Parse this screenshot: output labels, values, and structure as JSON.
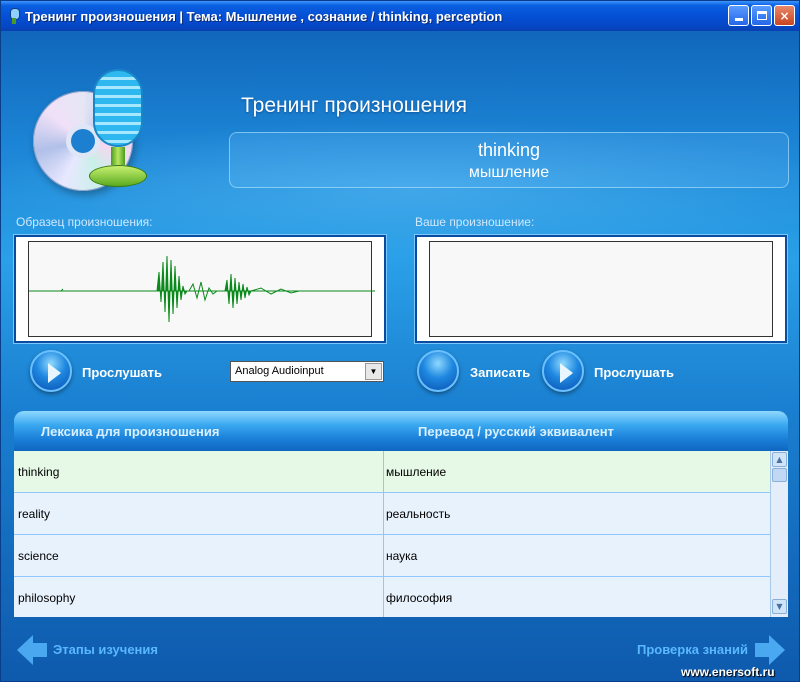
{
  "window": {
    "title": "Тренинг произношения | Тема:  Мышление , сознание / thinking, perception",
    "minimize_label": "",
    "maximize_label": "",
    "close_label": "×"
  },
  "header": {
    "app_title": "Тренинг произношения",
    "word_en": "thinking",
    "word_ru": "мышление"
  },
  "sample": {
    "label": "Образец произношения:",
    "play_label": "Прослушать"
  },
  "yours": {
    "label": "Ваше  произношение:",
    "record_label": "Записать",
    "play_label": "Прослушать"
  },
  "audio_input": {
    "selected": "Analog Audioinput",
    "arrow": "▼"
  },
  "table": {
    "col_vocab": "Лексика для произношения",
    "col_translation": "Перевод / русский эквивалент",
    "rows": [
      {
        "en": "thinking",
        "ru": "мышление"
      },
      {
        "en": "reality",
        "ru": "реальность"
      },
      {
        "en": "science",
        "ru": "наука"
      },
      {
        "en": "philosophy",
        "ru": "философия"
      }
    ],
    "scroll_up": "▲",
    "scroll_down": "▼"
  },
  "nav": {
    "back_label": "Этапы изучения",
    "next_label": "Проверка знаний"
  },
  "watermark": "www.enersoft.ru",
  "colors": {
    "waveform": "#0a8a1a",
    "accent": "#1a7fd8",
    "selected_row": "#e6f8e6"
  }
}
